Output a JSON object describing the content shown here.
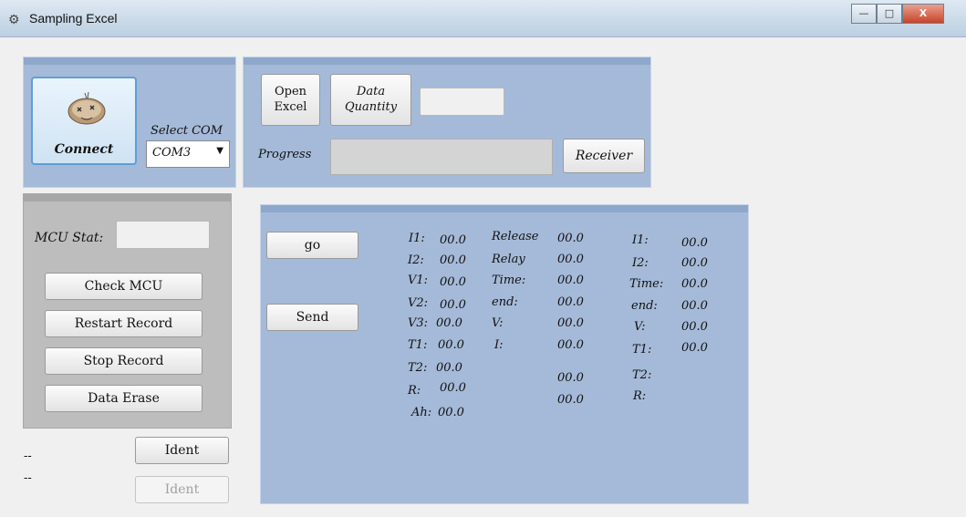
{
  "window": {
    "title": "Sampling Excel",
    "minimize_glyph": "—",
    "maximize_glyph": "□",
    "close_glyph": "X"
  },
  "connection": {
    "connect_label": "Connect",
    "select_com_label": "Select COM",
    "com_value": "COM3",
    "dropdown_glyph": "▼"
  },
  "excel": {
    "open_label_1": "Open",
    "open_label_2": "Excel",
    "data_label_1": "Data",
    "data_label_2": "Quantity",
    "quantity_value": "",
    "progress_label": "Progress",
    "progress_value": 0,
    "receiver_label": "Receiver"
  },
  "mcu": {
    "stat_label": "MCU Stat:",
    "stat_value": "",
    "check_label": "Check MCU",
    "restart_label": "Restart Record",
    "stop_label": "Stop Record",
    "erase_label": "Data Erase"
  },
  "ident": {
    "line1": "--",
    "line2": "--",
    "button1": "Ident",
    "button2": "Ident"
  },
  "readings": {
    "go_label": "go",
    "send_label": "Send",
    "col1_labels": [
      "I1:",
      "I2:",
      "V1:",
      "V2:",
      "V3:",
      "T1:",
      "T2:",
      "R:",
      "Ah:"
    ],
    "col1_values": [
      "00.0",
      "00.0",
      "00.0",
      "00.0",
      "00.0",
      "00.0",
      "00.0",
      "00.0",
      "00.0"
    ],
    "col2_labels": [
      "Release",
      "Relay",
      "Time:",
      "end:",
      "V:",
      "I:"
    ],
    "col2_values": [
      "00.0",
      "00.0",
      "00.0",
      "00.0",
      "00.0",
      "00.0",
      "00.0",
      "00.0"
    ],
    "col3_labels": [
      "I1:",
      "I2:",
      "Time:",
      "end:",
      "V:",
      "T1:",
      "T2:",
      "R:"
    ],
    "col3_values": [
      "00.0",
      "00.0",
      "00.0",
      "00.0",
      "00.0",
      "00.0"
    ]
  }
}
